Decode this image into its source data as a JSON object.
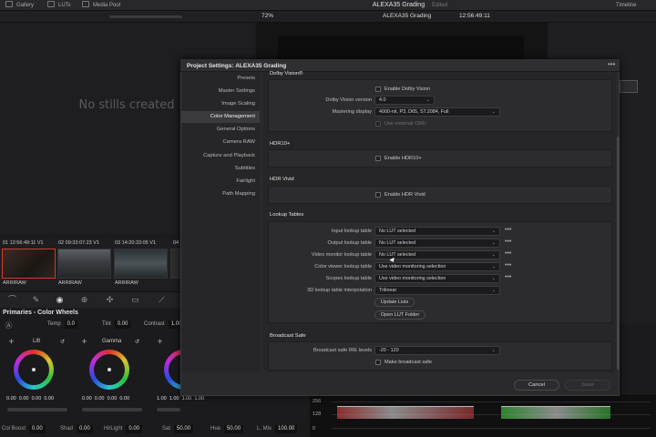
{
  "topbar": {
    "tabs": [
      {
        "label": "Gallery",
        "icon": "gallery-icon"
      },
      {
        "label": "LUTs",
        "icon": "luts-icon"
      },
      {
        "label": "Media Pool",
        "icon": "media-pool-icon"
      }
    ],
    "project_title": "ALEXA35 Grading",
    "edited_label": "Edited",
    "timeline_label": "Timeline"
  },
  "viewer_bar": {
    "zoom": "72%",
    "clip_name": "ALEXA35 Grading",
    "timecode": "12:56:49:11"
  },
  "gallery": {
    "empty_text": "No stills created"
  },
  "clips": [
    {
      "index": "01",
      "timecode": "12:56:49:11",
      "track": "V1",
      "codec": "ARRIRAW"
    },
    {
      "index": "02",
      "timecode": "09:33:07:23",
      "track": "V1",
      "codec": "ARRIRAW"
    },
    {
      "index": "03",
      "timecode": "14:20:33:05",
      "track": "V1",
      "codec": "ARRIRAW"
    },
    {
      "index": "04",
      "timecode": "",
      "track": "",
      "codec": ""
    }
  ],
  "primaries": {
    "title": "Primaries - Color Wheels",
    "temp_label": "Temp",
    "temp_value": "0.0",
    "tint_label": "Tint",
    "tint_value": "0.00",
    "contrast_label": "Contrast",
    "contrast_value": "1.000",
    "wheels": [
      {
        "label": "Lift",
        "values": [
          "0.00",
          "0.00",
          "0.00",
          "0.00"
        ]
      },
      {
        "label": "Gamma",
        "values": [
          "0.00",
          "0.00",
          "0.00",
          "0.00"
        ]
      },
      {
        "label": "",
        "values": [
          "1.00",
          "1.00",
          "1.00",
          "1.00"
        ]
      }
    ],
    "bottom": {
      "col_boost_label": "Col Boost",
      "col_boost_value": "0.00",
      "shad_label": "Shad",
      "shad_value": "0.00",
      "hilight_label": "Hi/Light",
      "hilight_value": "0.00",
      "sat_label": "Sat",
      "sat_value": "50.00",
      "hue_label": "Hue",
      "hue_value": "50.00",
      "lmix_label": "L. Mix",
      "lmix_value": "100.00"
    }
  },
  "scopes": {
    "labels": [
      "256",
      "128",
      "0"
    ]
  },
  "modal": {
    "title": "Project Settings:  ALEXA35 Grading",
    "nav": [
      "Presets",
      "Master Settings",
      "Image Scaling",
      "Color Management",
      "General Options",
      "Camera RAW",
      "Capture and Playback",
      "Subtitles",
      "Fairlight",
      "Path Mapping"
    ],
    "active_nav": "Color Management",
    "dolby": {
      "title": "Dolby Vision®",
      "enable_label": "Enable Dolby Vision",
      "version_label": "Dolby Vision version",
      "version_value": "4.0",
      "mastering_label": "Mastering display",
      "mastering_value": "4000-nit, P3, D65, ST.2084, Full",
      "external_label": "Use external CMU"
    },
    "hdr10": {
      "title": "HDR10+",
      "enable_label": "Enable HDR10+"
    },
    "hdrvivid": {
      "title": "HDR Vivid",
      "enable_label": "Enable HDR Vivid"
    },
    "luts": {
      "title": "Lookup Tables",
      "rows": [
        {
          "label": "Input lookup table",
          "value": "No LUT selected"
        },
        {
          "label": "Output lookup table",
          "value": "No LUT selected"
        },
        {
          "label": "Video monitor lookup table",
          "value": "No LUT selected"
        },
        {
          "label": "Color viewer lookup table",
          "value": "Use video monitoring selection"
        },
        {
          "label": "Scopes lookup table",
          "value": "Use video monitoring selection"
        },
        {
          "label": "3D lookup table interpolation",
          "value": "Trilinear"
        }
      ],
      "update_button": "Update Lists",
      "open_folder_button": "Open LUT Folder"
    },
    "broadcast": {
      "title": "Broadcast Safe",
      "ire_label": "Broadcast safe IRE levels",
      "ire_value": "-20 - 120",
      "make_safe_label": "Make broadcast safe"
    },
    "cancel_button": "Cancel",
    "save_button": "Save"
  }
}
